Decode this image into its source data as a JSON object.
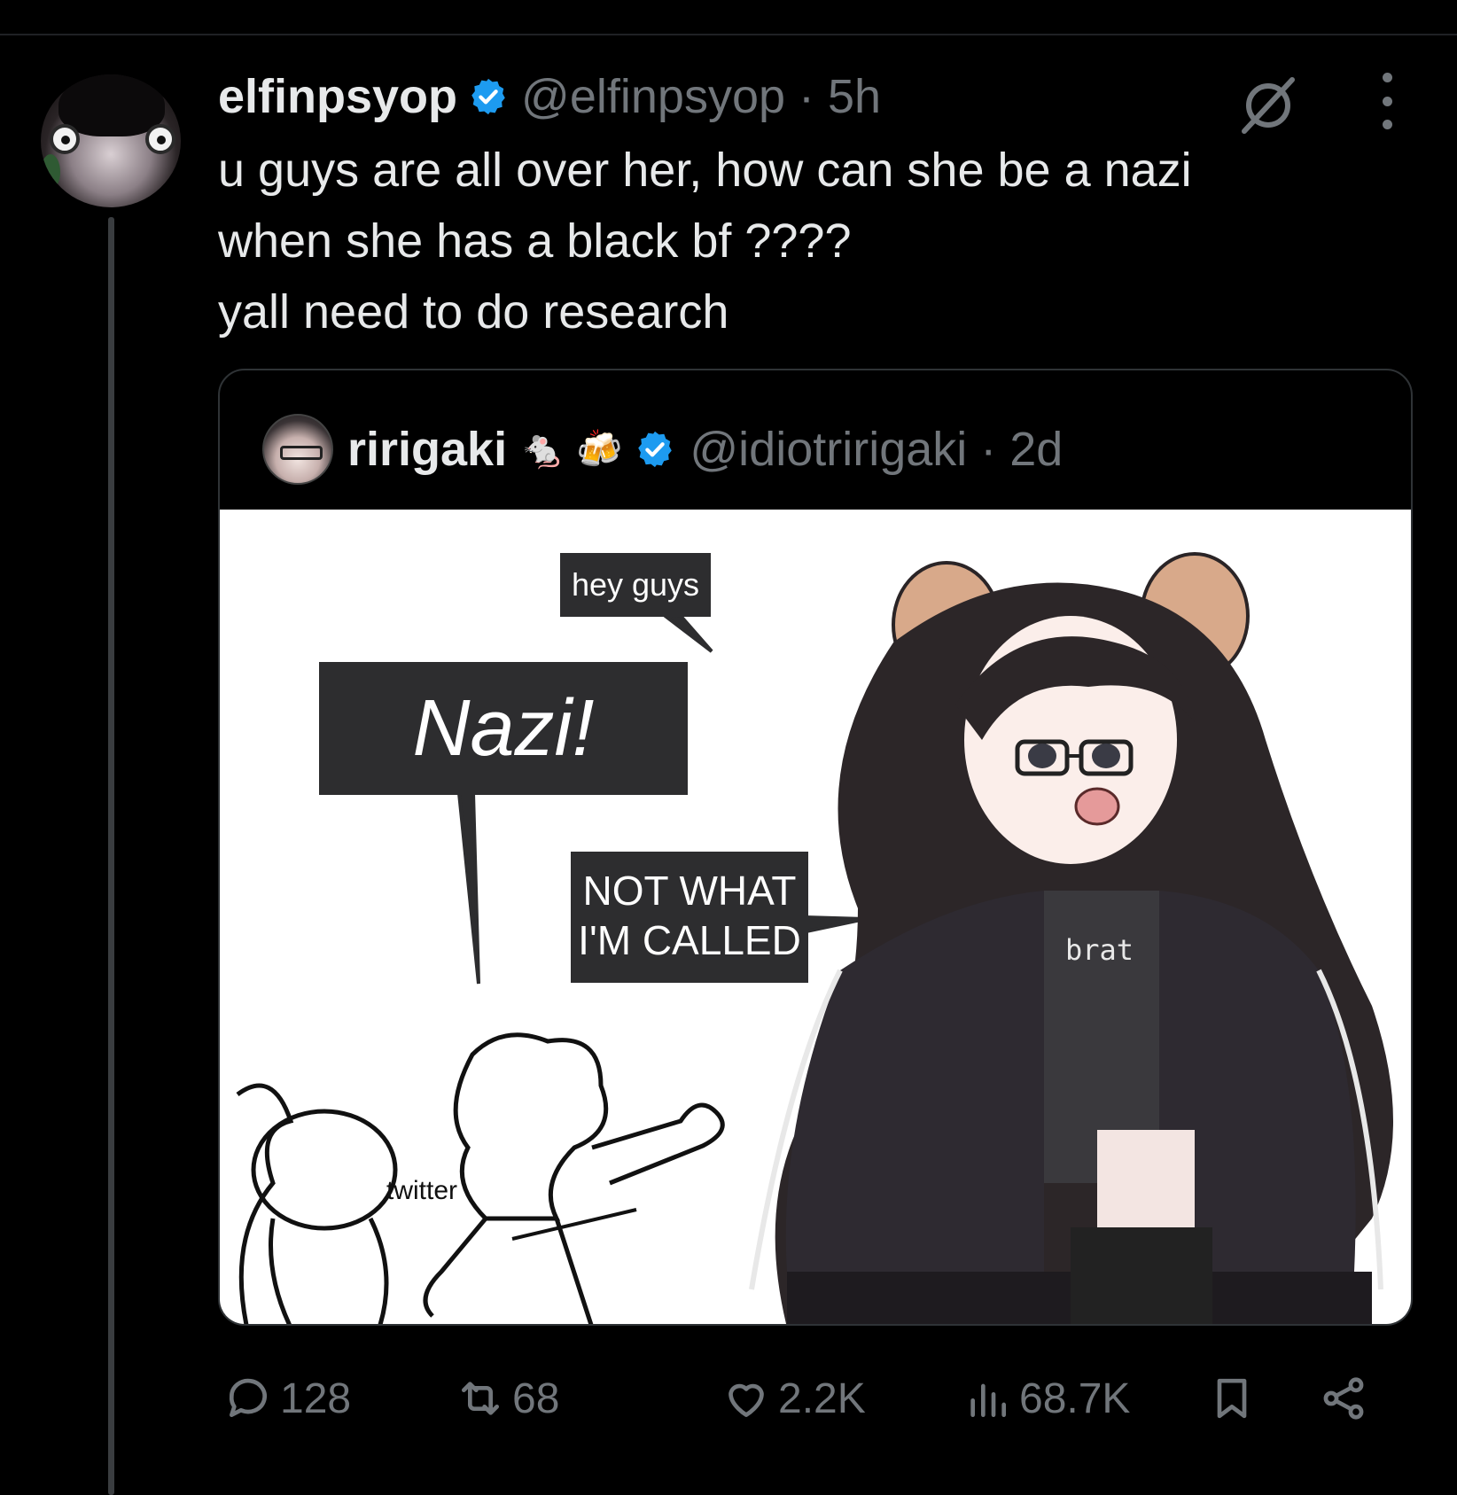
{
  "post": {
    "display_name": "elfinpsyop",
    "handle_time": "@elfinpsyop · 5h",
    "text_lines": [
      "u guys are all over her, how can she be a nazi",
      "when she has a black bf ????",
      "yall need to do research"
    ]
  },
  "quote": {
    "display_name": "ririgaki",
    "emojis": "🐁 🍻",
    "handle_time": "@idiotririgaki · 2d",
    "meme": {
      "bubble_hey": "hey guys",
      "bubble_nazi": "Nazi!",
      "bubble_not_line1": "NOT WHAT",
      "bubble_not_line2": "I'M CALLED",
      "label_twitter": "twitter",
      "shirt_text": "brat"
    }
  },
  "actions": {
    "replies": "128",
    "reposts": "68",
    "likes": "2.2K",
    "views": "68.7K"
  },
  "icons": [
    "verified-badge-icon",
    "grok-icon",
    "more-icon",
    "reply-icon",
    "repost-icon",
    "like-icon",
    "views-icon",
    "bookmark-icon",
    "share-icon"
  ],
  "colors": {
    "verified": "#1d9bf0",
    "muted": "#71767b",
    "text": "#e7e9ea"
  }
}
